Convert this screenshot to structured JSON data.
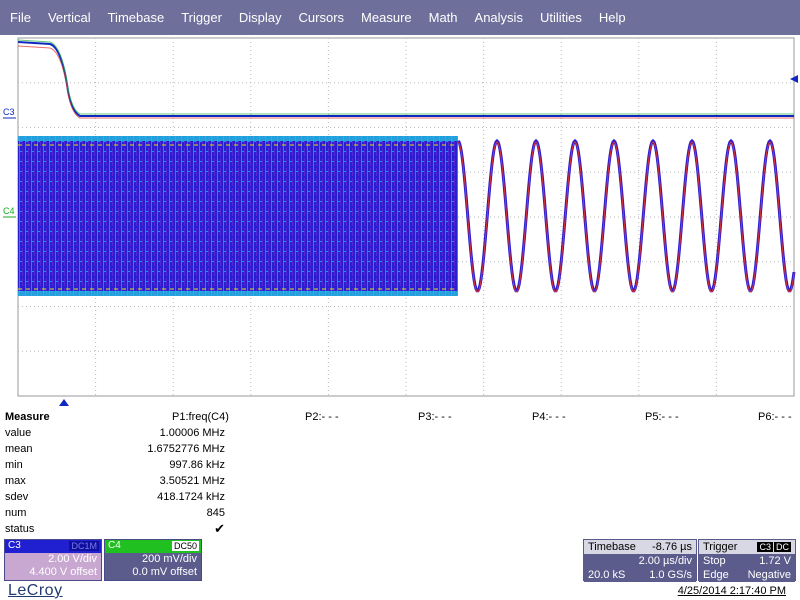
{
  "menu": [
    "File",
    "Vertical",
    "Timebase",
    "Trigger",
    "Display",
    "Cursors",
    "Measure",
    "Math",
    "Analysis",
    "Utilities",
    "Help"
  ],
  "channel_markers": {
    "c3": "C3",
    "c4": "C4"
  },
  "measure": {
    "title": "Measure",
    "row_labels": [
      "value",
      "mean",
      "min",
      "max",
      "sdev",
      "num",
      "status"
    ],
    "params": [
      {
        "name": "P1:freq(C4)",
        "values": [
          "1.00006 MHz",
          "1.6752776 MHz",
          "997.86 kHz",
          "3.50521 MHz",
          "418.1724 kHz",
          "845"
        ],
        "status": "✔"
      },
      {
        "name": "P2:- - -"
      },
      {
        "name": "P3:- - -"
      },
      {
        "name": "P4:- - -"
      },
      {
        "name": "P5:- - -"
      },
      {
        "name": "P6:- - -"
      }
    ]
  },
  "channels": {
    "c3": {
      "label": "C3",
      "coupling": "DC1M",
      "scale": "2.00 V/div",
      "offset": "4.400 V offset"
    },
    "c4": {
      "label": "C4",
      "coupling": "DC50",
      "scale": "200 mV/div",
      "offset": "0.0 mV offset"
    }
  },
  "timebase": {
    "label": "Timebase",
    "delay": "-8.76 µs",
    "per_div": "2.00 µs/div",
    "samples": "20.0 kS",
    "rate": "1.0 GS/s"
  },
  "trigger": {
    "label": "Trigger",
    "source": "C3",
    "coupling": "DC",
    "mode": "Stop",
    "level": "1.72 V",
    "type": "Edge",
    "slope": "Negative"
  },
  "brand": "LeCroy",
  "datetime": "4/25/2014 2:17:40 PM",
  "colors": {
    "menu_bg": "#6f6f9c",
    "c3_color": "#1030c0",
    "c4_color": "#18a820",
    "grid": "#888888"
  }
}
